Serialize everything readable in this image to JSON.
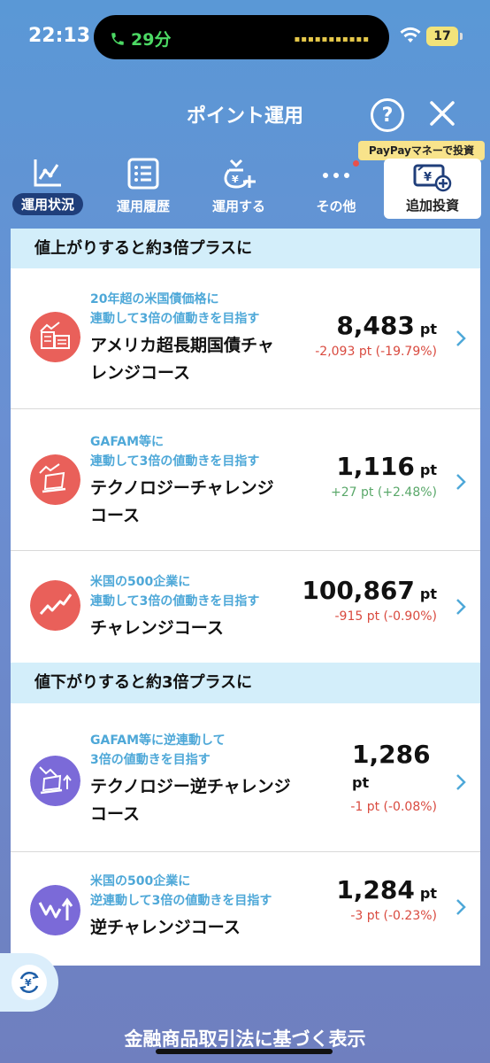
{
  "status_bar": {
    "time": "22:13",
    "call_duration": "29分",
    "battery": "17"
  },
  "header": {
    "title": "ポイント運用",
    "help_label": "?"
  },
  "tabs": [
    {
      "label": "運用状況",
      "icon": "chart-line-icon",
      "active": true
    },
    {
      "label": "運用履歴",
      "icon": "list-icon",
      "active": false
    },
    {
      "label": "運用する",
      "icon": "money-bag-plus-icon",
      "active": false
    },
    {
      "label": "その他",
      "icon": "more-dots-icon",
      "active": false
    },
    {
      "label": "追加投資",
      "icon": "yen-card-plus-icon",
      "active": false
    }
  ],
  "paypay_badge": "PayPayマネーで投資",
  "sections": [
    {
      "title": "値上がりすると約3倍プラスに"
    },
    {
      "title": "値下がりすると約3倍プラスに"
    }
  ],
  "courses": [
    {
      "desc": "20年超の米国債価格に\n連動して3倍の値動きを目指す",
      "name": "アメリカ超長期国債チャ\nレンジコース",
      "points": "8,483",
      "unit": "pt",
      "change": "-2,093 pt (-19.79%)",
      "trend": "down",
      "icon": "bond-chart-icon",
      "icon_color": "#e9605a"
    },
    {
      "desc": "GAFAM等に\n連動して3倍の値動きを目指す",
      "name": "テクノロジーチャレンジ\nコース",
      "points": "1,116",
      "unit": "pt",
      "change": "+27 pt (+2.48%)",
      "trend": "up",
      "icon": "laptop-chart-icon",
      "icon_color": "#e9605a"
    },
    {
      "desc": "米国の500企業に\n連動して3倍の値動きを目指す",
      "name": "チャレンジコース",
      "points": "100,867",
      "unit": "pt",
      "change": "-915 pt (-0.90%)",
      "trend": "down",
      "icon": "trend-up-icon",
      "icon_color": "#e9605a"
    },
    {
      "desc": "GAFAM等に逆連動して\n3倍の値動きを目指す",
      "name": "テクノロジー逆チャレンジ\nコース",
      "points": "1,286",
      "unit": "pt",
      "change": "-1 pt (-0.08%)",
      "trend": "down",
      "icon": "laptop-reverse-icon",
      "icon_color": "#7b6ad8"
    },
    {
      "desc": "米国の500企業に\n逆連動して3倍の値動きを目指す",
      "name": "逆チャレンジコース",
      "points": "1,284",
      "unit": "pt",
      "change": "-3 pt (-0.23%)",
      "trend": "down",
      "icon": "reverse-trend-icon",
      "icon_color": "#7b6ad8"
    }
  ],
  "colors": {
    "down": "#d94a3f",
    "up": "#5aa86a",
    "accent_blue": "#4ea8d8",
    "section_bg": "#d3eefa"
  },
  "footer": {
    "legal_link": "金融商品取引法に基づく表示"
  }
}
